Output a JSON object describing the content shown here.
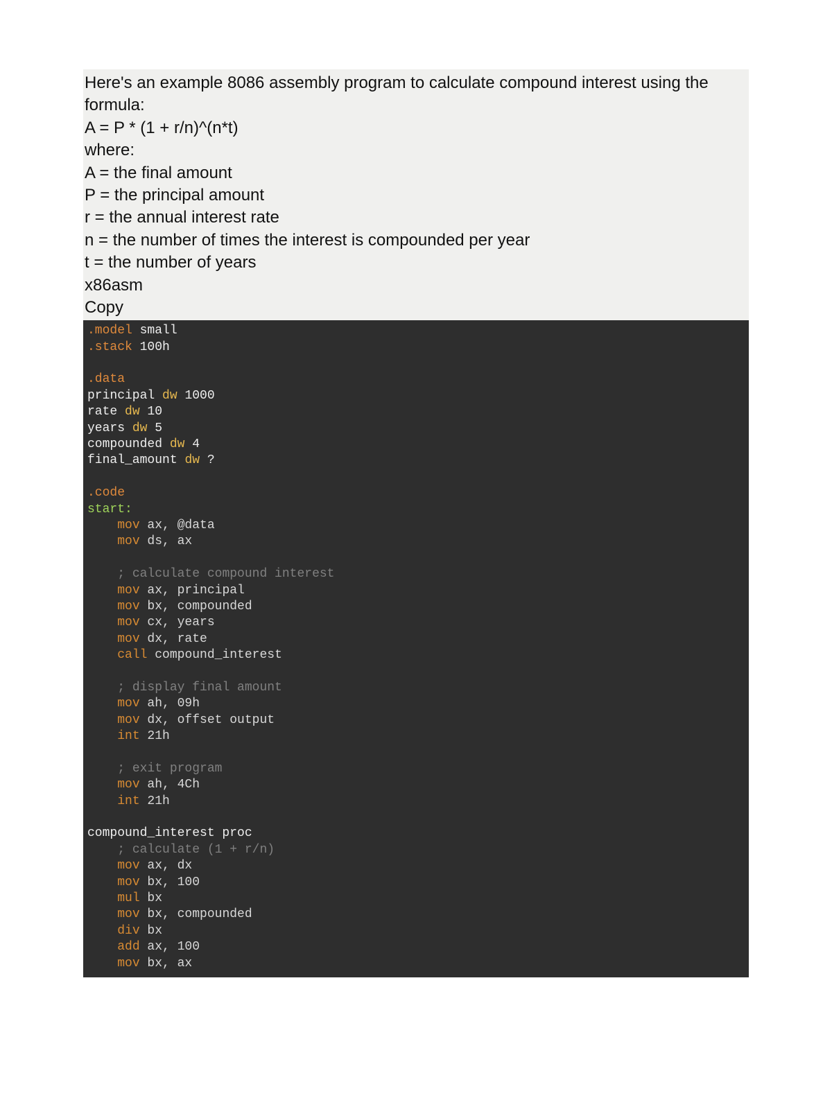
{
  "intro": {
    "lines": [
      "Here's an example 8086 assembly program to calculate compound interest using the formula:",
      "A = P * (1 + r/n)^(n*t)",
      "where:",
      "A = the final amount",
      "P = the principal amount",
      "r = the annual interest rate",
      "n = the number of times the interest is compounded per year",
      "t = the number of years"
    ],
    "lang_label": "x86asm",
    "copy_label": "Copy"
  },
  "code": {
    "l1_dir": ".model",
    "l1_arg": " small",
    "l2_dir": ".stack",
    "l2_arg": " 100h",
    "l4_dir": ".data",
    "l5_id": "principal ",
    "l5_kw": "dw",
    "l5_val": " 1000",
    "l6_id": "rate ",
    "l6_kw": "dw",
    "l6_val": " 10",
    "l7_id": "years ",
    "l7_kw": "dw",
    "l7_val": " 5",
    "l8_id": "compounded ",
    "l8_kw": "dw",
    "l8_val": " 4",
    "l9_id": "final_amount ",
    "l9_kw": "dw",
    "l9_val": " ?",
    "l11_dir": ".code",
    "l12_lbl": "start:",
    "l13_op": "mov",
    "l13_rest": " ax, @data",
    "l14_op": "mov",
    "l14_rest": " ds, ax",
    "l16_cmt": "; calculate compound interest",
    "l17_op": "mov",
    "l17_rest": " ax, principal",
    "l18_op": "mov",
    "l18_rest": " bx, compounded",
    "l19_op": "mov",
    "l19_rest": " cx, years",
    "l20_op": "mov",
    "l20_rest": " dx, rate",
    "l21_op": "call",
    "l21_rest": " compound_interest",
    "l23_cmt": "; display final amount",
    "l24_op": "mov",
    "l24_rest": " ah, 09h",
    "l25_op": "mov",
    "l25_rest": " dx, offset output",
    "l26_op": "int",
    "l26_rest": " 21h",
    "l28_cmt": "; exit program",
    "l29_op": "mov",
    "l29_rest": " ah, 4Ch",
    "l30_op": "int",
    "l30_rest": " 21h",
    "l32_id": "compound_interest proc",
    "l33_cmt": "; calculate (1 + r/n)",
    "l34_op": "mov",
    "l34_rest": " ax, dx",
    "l35_op": "mov",
    "l35_rest": " bx, 100",
    "l36_op": "mul",
    "l36_rest": " bx",
    "l37_op": "mov",
    "l37_rest": " bx, compounded",
    "l38_op": "div",
    "l38_rest": " bx",
    "l39_op": "add",
    "l39_rest": " ax, 100",
    "l40_op": "mov",
    "l40_rest": " bx, ax"
  }
}
